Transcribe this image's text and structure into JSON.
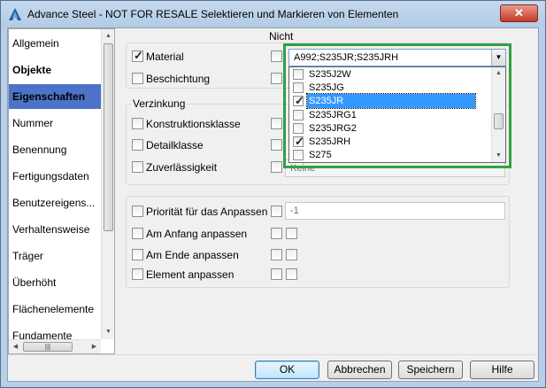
{
  "window": {
    "title": "Advance Steel - NOT FOR RESALE  Selektieren und Markieren von Elementen",
    "close_label": "✕"
  },
  "sidebar": {
    "items": [
      {
        "label": "Allgemein",
        "style": "normal"
      },
      {
        "label": "Objekte",
        "style": "bold"
      },
      {
        "label": "Eigenschaften",
        "style": "active"
      },
      {
        "label": "Nummer",
        "style": "normal"
      },
      {
        "label": "Benennung",
        "style": "normal"
      },
      {
        "label": "Fertigungsdaten",
        "style": "normal"
      },
      {
        "label": "Benutzereigens...",
        "style": "normal"
      },
      {
        "label": "Verhaltensweise",
        "style": "normal"
      },
      {
        "label": "Träger",
        "style": "normal"
      },
      {
        "label": "Überhöht",
        "style": "normal"
      },
      {
        "label": "Flächenelemente",
        "style": "normal"
      },
      {
        "label": "Fundamente",
        "style": "normal"
      }
    ],
    "hscroll_thumb": "|||"
  },
  "main": {
    "nicht_label": "Nicht",
    "material": {
      "label": "Material",
      "checked": true,
      "value": "A992;S235JR;S235JRH"
    },
    "beschichtung": {
      "label": "Beschichtung",
      "checked": false
    },
    "verzinkung": {
      "group_label": "Verzinkung",
      "konstruktionsklasse": {
        "label": "Konstruktionsklasse"
      },
      "detailklasse": {
        "label": "Detailklasse"
      },
      "zuverlaessigkeit": {
        "label": "Zuverlässigkeit",
        "value": "Keine"
      }
    },
    "anpassen": {
      "prioritaet": {
        "label": "Priorität für das Anpassen",
        "value": "-1"
      },
      "am_anfang": {
        "label": "Am Anfang anpassen"
      },
      "am_ende": {
        "label": "Am Ende anpassen"
      },
      "element": {
        "label": "Element anpassen"
      }
    },
    "dropdown_options": [
      {
        "label": "S235J2W",
        "checked": false,
        "selected": false
      },
      {
        "label": "S235JG",
        "checked": false,
        "selected": false
      },
      {
        "label": "S235JR",
        "checked": true,
        "selected": true
      },
      {
        "label": "S235JRG1",
        "checked": false,
        "selected": false
      },
      {
        "label": "S235JRG2",
        "checked": false,
        "selected": false
      },
      {
        "label": "S235JRH",
        "checked": true,
        "selected": false
      },
      {
        "label": "S275",
        "checked": false,
        "selected": false
      }
    ]
  },
  "footer": {
    "ok": "OK",
    "abbrechen": "Abbrechen",
    "speichern": "Speichern",
    "hilfe": "Hilfe"
  },
  "colors": {
    "accent": "#4d73c9",
    "highlight_border": "#32a043",
    "selection": "#3399ff"
  }
}
